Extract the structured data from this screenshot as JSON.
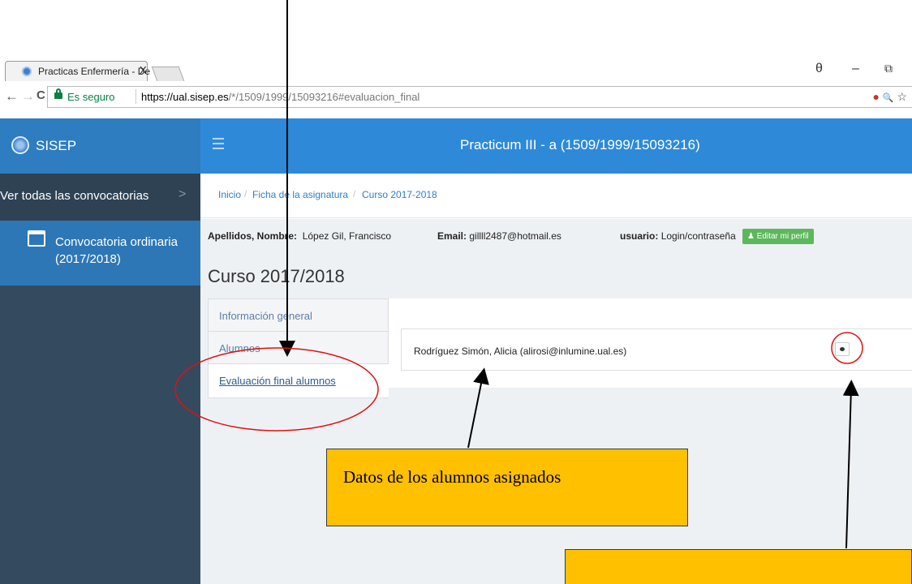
{
  "browser": {
    "tab_title": "Practicas Enfermería - De",
    "tab_close": "X",
    "account_glyph": "θ",
    "minimize_glyph": "–",
    "restore_glyph": "⧉",
    "secure_label": "Es seguro",
    "url_host": "https://ual.sisep.es",
    "url_path": "/*/1509/1999/15093216#evaluacion_final",
    "back_glyph": "←",
    "forward_glyph": "→",
    "reload_glyph": "C",
    "zoom_glyph": "🔍",
    "star_glyph": "☆"
  },
  "sidebar": {
    "brand": "SISEP",
    "all_calls": "Ver todas las convocatorias",
    "chevron": ">",
    "call_item_line1": "Convocatoria ordinaria",
    "call_item_line2": "(2017/2018)"
  },
  "header": {
    "title": "Practicum III - a (1509/1999/15093216)"
  },
  "breadcrumb": {
    "items": [
      "Inicio",
      "Ficha de la asignatura",
      "Curso 2017-2018"
    ],
    "separator": "/"
  },
  "profile": {
    "name_label": "Apellidos, Nombre:",
    "name_value": "López Gil, Francisco",
    "email_label": "Email:",
    "email_value": "gillll2487@hotmail.es",
    "user_label": "usuario:",
    "user_value": "Login/contraseña",
    "edit_button": "Editar mi perfil"
  },
  "course": {
    "title": "Curso 2017/2018",
    "tabs": [
      "Información general",
      "Alumnos",
      "Evaluación final alumnos"
    ],
    "active_tab_index": 2
  },
  "students": [
    {
      "name": "Rodríguez Simón, Alicia (alirosi@inlumine.ual.es)"
    }
  ],
  "annotations": {
    "callout_text": "Datos de los alumnos asignados",
    "callout_color": "#ffc000",
    "circle_color": "#e01010"
  },
  "colors": {
    "sidebar": "#344a5f",
    "brand": "#2d7dc0",
    "topbar": "#2e8ad8",
    "active_item": "#2e77b6",
    "edit_button": "#5cb85c"
  }
}
